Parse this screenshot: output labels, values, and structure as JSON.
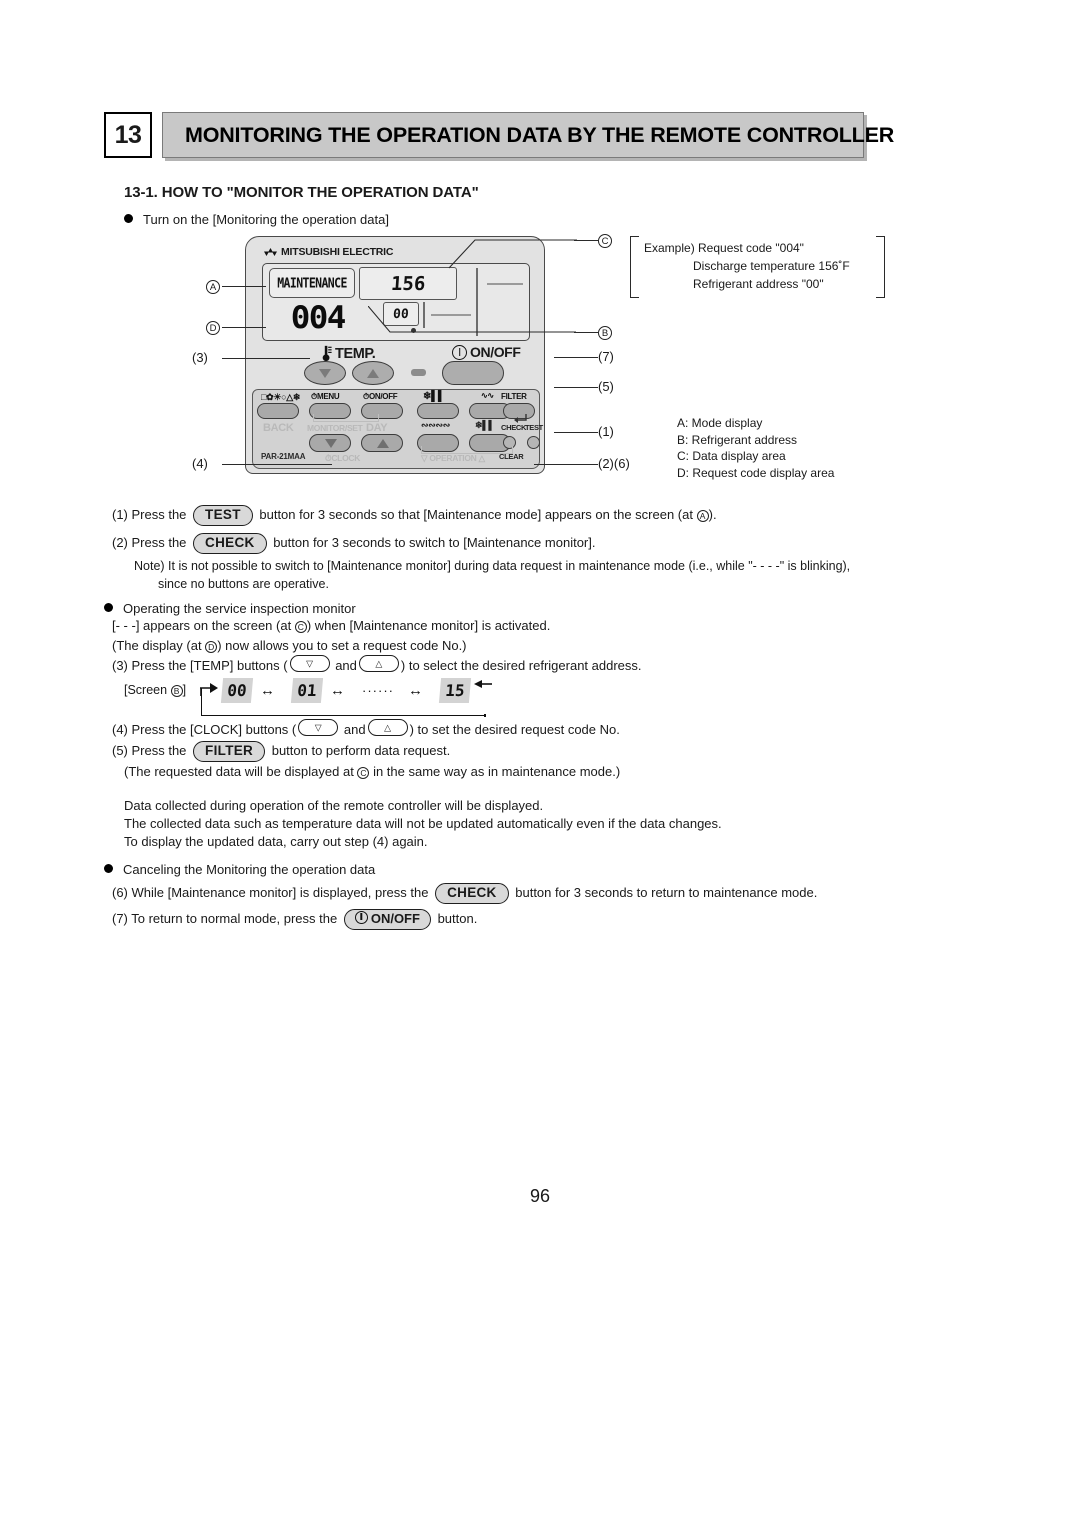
{
  "header": {
    "chapter_number": "13",
    "chapter_title": "MONITORING THE OPERATION DATA BY THE REMOTE CONTROLLER"
  },
  "section": {
    "title": "13-1. HOW TO \"MONITOR THE OPERATION DATA\"",
    "intro_bullet": "Turn on the  [Monitoring the operation data]"
  },
  "controller": {
    "brand": "MITSUBISHI ELECTRIC",
    "model": "PAR-21MAA",
    "lcd": {
      "mode_text": "MAINTENANCE",
      "request_code": "004",
      "data_value": "156",
      "refrigerant_address": "00"
    },
    "temp_label": "TEMP.",
    "onoff_label": "ON/OFF",
    "icon_row": {
      "mode_icons": "□✿☀○△❄",
      "menu": "MENU",
      "timer_onoff": "ON/OFF",
      "fan": "fan-speed-icon",
      "louver": "louver-icon",
      "filter": "FILTER"
    },
    "sub_labels": {
      "back": "BACK",
      "monitor_set": "MONITOR/SET",
      "day": "DAY",
      "clock": "CLOCK",
      "operation": "OPERATION",
      "check": "CHECK",
      "test": "TEST",
      "clear": "CLEAR"
    }
  },
  "callouts": {
    "left": [
      {
        "id": "A",
        "kind": "circle"
      },
      {
        "id": "D",
        "kind": "circle"
      },
      {
        "id": "(3)",
        "kind": "plain"
      },
      {
        "id": "(4)",
        "kind": "plain"
      }
    ],
    "right": [
      {
        "id": "C",
        "kind": "circle"
      },
      {
        "id": "B",
        "kind": "circle"
      },
      {
        "id": "(7)",
        "kind": "plain"
      },
      {
        "id": "(5)",
        "kind": "plain"
      },
      {
        "id": "(1)",
        "kind": "plain"
      },
      {
        "id": "(2)(6)",
        "kind": "plain"
      }
    ]
  },
  "example": {
    "lines": [
      "Example)  Request code  \"004\"",
      "Discharge temperature 156˚F",
      "Refrigerant address \"00\""
    ]
  },
  "legend": {
    "items": [
      "A: Mode display",
      "B: Refrigerant address",
      "C: Data display area",
      "D: Request code display area"
    ]
  },
  "steps": {
    "s1_pre": "(1) Press the",
    "s1_key": "TEST",
    "s1_post": "button for 3 seconds so that [Maintenance mode] appears on the screen (at",
    "s1_ref": "A",
    "s1_end": ").",
    "s2_pre": "(2) Press the",
    "s2_key": "CHECK",
    "s2_post": "button for 3 seconds to switch to [Maintenance monitor].",
    "note1": "Note) It is not possible to switch to [Maintenance monitor] during data request in maintenance mode (i.e., while \"- - - -\" is blinking),",
    "note2": "since no buttons are operative.",
    "bullet2": "Operating the service inspection monitor",
    "l1_pre": "[- - -] appears on the screen (at",
    "l1_ref": "C",
    "l1_post": ") when [Maintenance monitor] is activated.",
    "l2_pre": "(The display (at",
    "l2_ref": "D",
    "l2_post": ") now allows you to set a request code No.)",
    "s3_pre": "(3) Press the [TEMP] buttons (",
    "s3_mid": "and",
    "s3_post": ") to select the desired refrigerant address.",
    "s4_pre": "(4) Press the [CLOCK] buttons (",
    "s4_mid": "and",
    "s4_post": ") to set the desired request code No.",
    "s5_pre": "(5) Press the",
    "s5_key": "FILTER",
    "s5_post": "button to perform data request.",
    "s5_note_pre": "(The requested data will be displayed at",
    "s5_note_ref": "C",
    "s5_note_post": "in the same way as in maintenance mode.)",
    "p1": "Data collected during operation of the remote controller will be displayed.",
    "p2": "The collected data such as temperature data will not be updated automatically even if the data changes.",
    "p3": "To display the updated data, carry out step (4) again.",
    "bullet3": "Canceling the Monitoring the operation data",
    "s6_pre": "(6) While [Maintenance monitor] is displayed, press the",
    "s6_key": "CHECK",
    "s6_post": "button for 3 seconds to return to maintenance mode.",
    "s7_pre": "(7) To return to normal mode, press the",
    "s7_key": "ON/OFF",
    "s7_post": "button."
  },
  "screen_sequence": {
    "tag_pre": "[Screen",
    "tag_ref": "B",
    "tag_post": "]",
    "cells": [
      "00",
      "01",
      "15"
    ],
    "dots": "······",
    "arrow": "↔"
  },
  "page_number": "96",
  "colors": {
    "header_bar": "#c8c8c8",
    "controller_body": "#e2e2e2",
    "lcd_bg": "#e8e8e8",
    "button_gray": "#adadad",
    "seq_cell": "#d3d3d3"
  }
}
